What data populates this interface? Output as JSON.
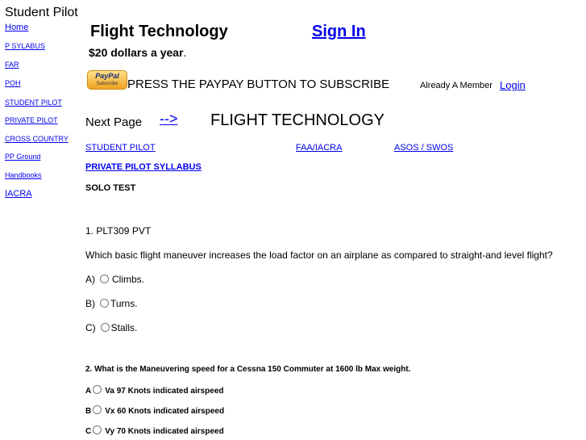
{
  "sidebar": {
    "title": "Student Pilot",
    "links": [
      "Home",
      "P SYLABUS",
      "FAR",
      "POH",
      "STUDENT PILOT",
      "PRIVATE  PILOT",
      "CROSS COUNTRY",
      "PP Ground",
      "Handbooks",
      "IACRA"
    ]
  },
  "header": {
    "title": "Flight Technology",
    "sign_in": "Sign In",
    "price": "$20 dollars a year",
    "price_suffix": "."
  },
  "subscribe": {
    "paypal_brand": "PayPal",
    "paypal_label": "Subscribe",
    "press_text": "PRESS THE PAYPAY BUTTON TO SUBSCRIBE",
    "already_member": "Already A Member",
    "login": "Login"
  },
  "nav": {
    "next_page": "Next Page",
    "arrow": "-->",
    "section_title": "FLIGHT TECHNOLOGY",
    "student_pilot": "STUDENT PILOT",
    "faa_iacra": "FAA/IACRA",
    "asos_swos": "ASOS / SWOS",
    "private_pilot_syllabus": "PRIVATE PILOT SYLLABUS",
    "solo_test": "SOLO TEST"
  },
  "question1": {
    "number": "1. PLT309 PVT",
    "text": "Which basic flight maneuver increases the load factor on an airplane as compared to straight-and level flight?",
    "options": [
      {
        "letter": "A)",
        "text": "Climbs."
      },
      {
        "letter": "B)",
        "text": "Turns."
      },
      {
        "letter": "C)",
        "text": "Stalls."
      }
    ]
  },
  "question2": {
    "text": "2. What is the Maneuvering speed  for a Cessna 150 Commuter at 1600 lb Max weight.",
    "options": [
      {
        "letter": "A",
        "text": "Va  97 Knots indicated airspeed"
      },
      {
        "letter": "B",
        "text": "Vx  60 Knots indicated airspeed"
      },
      {
        "letter": "C",
        "text": "Vy  70 Knots indicated airspeed"
      }
    ]
  }
}
